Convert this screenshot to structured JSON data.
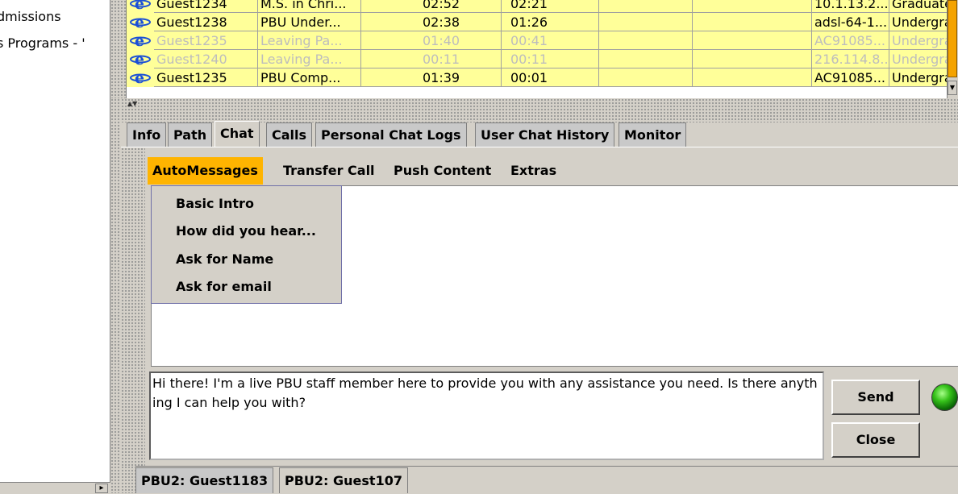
{
  "left_pane": {
    "items": [
      "dmissions",
      "s Programs - '"
    ]
  },
  "visitor_table": {
    "rows": [
      {
        "name": "Guest1234",
        "page": "M.S. in Chri...",
        "time1": "02:52",
        "time2": "02:21",
        "col5": "",
        "col6": "",
        "host": "10.1.13.2...",
        "type": "Graduate",
        "faded": false
      },
      {
        "name": "Guest1238",
        "page": "PBU Under...",
        "time1": "02:38",
        "time2": "01:26",
        "col5": "",
        "col6": "",
        "host": "adsl-64-1...",
        "type": "Undergrad",
        "faded": false
      },
      {
        "name": "Guest1235",
        "page": "Leaving Pa...",
        "time1": "01:40",
        "time2": "00:41",
        "col5": "",
        "col6": "",
        "host": "AC91085...",
        "type": "Undergrad",
        "faded": true
      },
      {
        "name": "Guest1240",
        "page": "Leaving Pa...",
        "time1": "00:11",
        "time2": "00:11",
        "col5": "",
        "col6": "",
        "host": "216.114.8...",
        "type": "Undergrad",
        "faded": true
      },
      {
        "name": "Guest1235",
        "page": "PBU Comp...",
        "time1": "01:39",
        "time2": "00:01",
        "col5": "",
        "col6": "",
        "host": "AC91085...",
        "type": "Undergrad",
        "faded": false
      }
    ]
  },
  "tabs": [
    {
      "label": "Info",
      "active": false
    },
    {
      "label": "Path",
      "active": false
    },
    {
      "label": "Chat",
      "active": true
    },
    {
      "label": "Calls",
      "active": false
    },
    {
      "label": "Personal Chat Logs",
      "active": false
    },
    {
      "label": "User Chat History",
      "active": false
    },
    {
      "label": "Monitor",
      "active": false
    }
  ],
  "menubar": {
    "items": [
      "AutoMessages",
      "Transfer Call",
      "Push Content",
      "Extras"
    ],
    "open": "AutoMessages"
  },
  "automessages_menu": {
    "items": [
      "Basic Intro",
      "How did you hear...",
      "Ask for Name",
      "Ask for email"
    ]
  },
  "message_input": {
    "value": "Hi there!  I'm a live PBU staff member here to provide you with any assistance you need. Is there anything I can help you with?"
  },
  "buttons": {
    "send_label": "Send",
    "close_label": "Close"
  },
  "status_light": {
    "color": "#36c21a"
  },
  "session_tabs": [
    {
      "label": "PBU2: Guest1183",
      "active": true
    },
    {
      "label": "PBU2: Guest107",
      "active": false
    }
  ],
  "colors": {
    "row_highlight": "#ffff99",
    "menu_open": "#ffb400",
    "scroll_thumb": "#f4a300"
  }
}
